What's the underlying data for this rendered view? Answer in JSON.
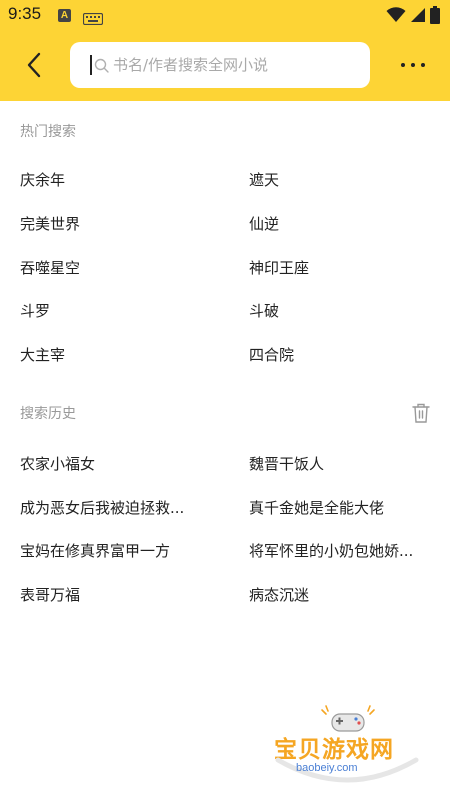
{
  "status_bar": {
    "time": "9:35",
    "notif_letter": "A"
  },
  "search": {
    "placeholder": "书名/作者搜索全网小说"
  },
  "hot_search": {
    "title": "热门搜索",
    "left": [
      "庆余年",
      "完美世界",
      "吞噬星空",
      "斗罗",
      "大主宰"
    ],
    "right": [
      "遮天",
      "仙逆",
      "神印王座",
      "斗破",
      "四合院"
    ]
  },
  "history": {
    "title": "搜索历史",
    "left": [
      "农家小福女",
      "成为恶女后我被迫拯救...",
      "宝妈在修真界富甲一方",
      "表哥万福"
    ],
    "right": [
      "魏晋干饭人",
      "真千金她是全能大佬",
      "将军怀里的小奶包她娇...",
      "病态沉迷"
    ]
  },
  "watermark": {
    "brand": "宝贝游戏网",
    "url": "baobeiy.com"
  },
  "colors": {
    "header": "#fdd435",
    "section_title": "#999999",
    "text": "#222222",
    "watermark": "#f5a623"
  }
}
